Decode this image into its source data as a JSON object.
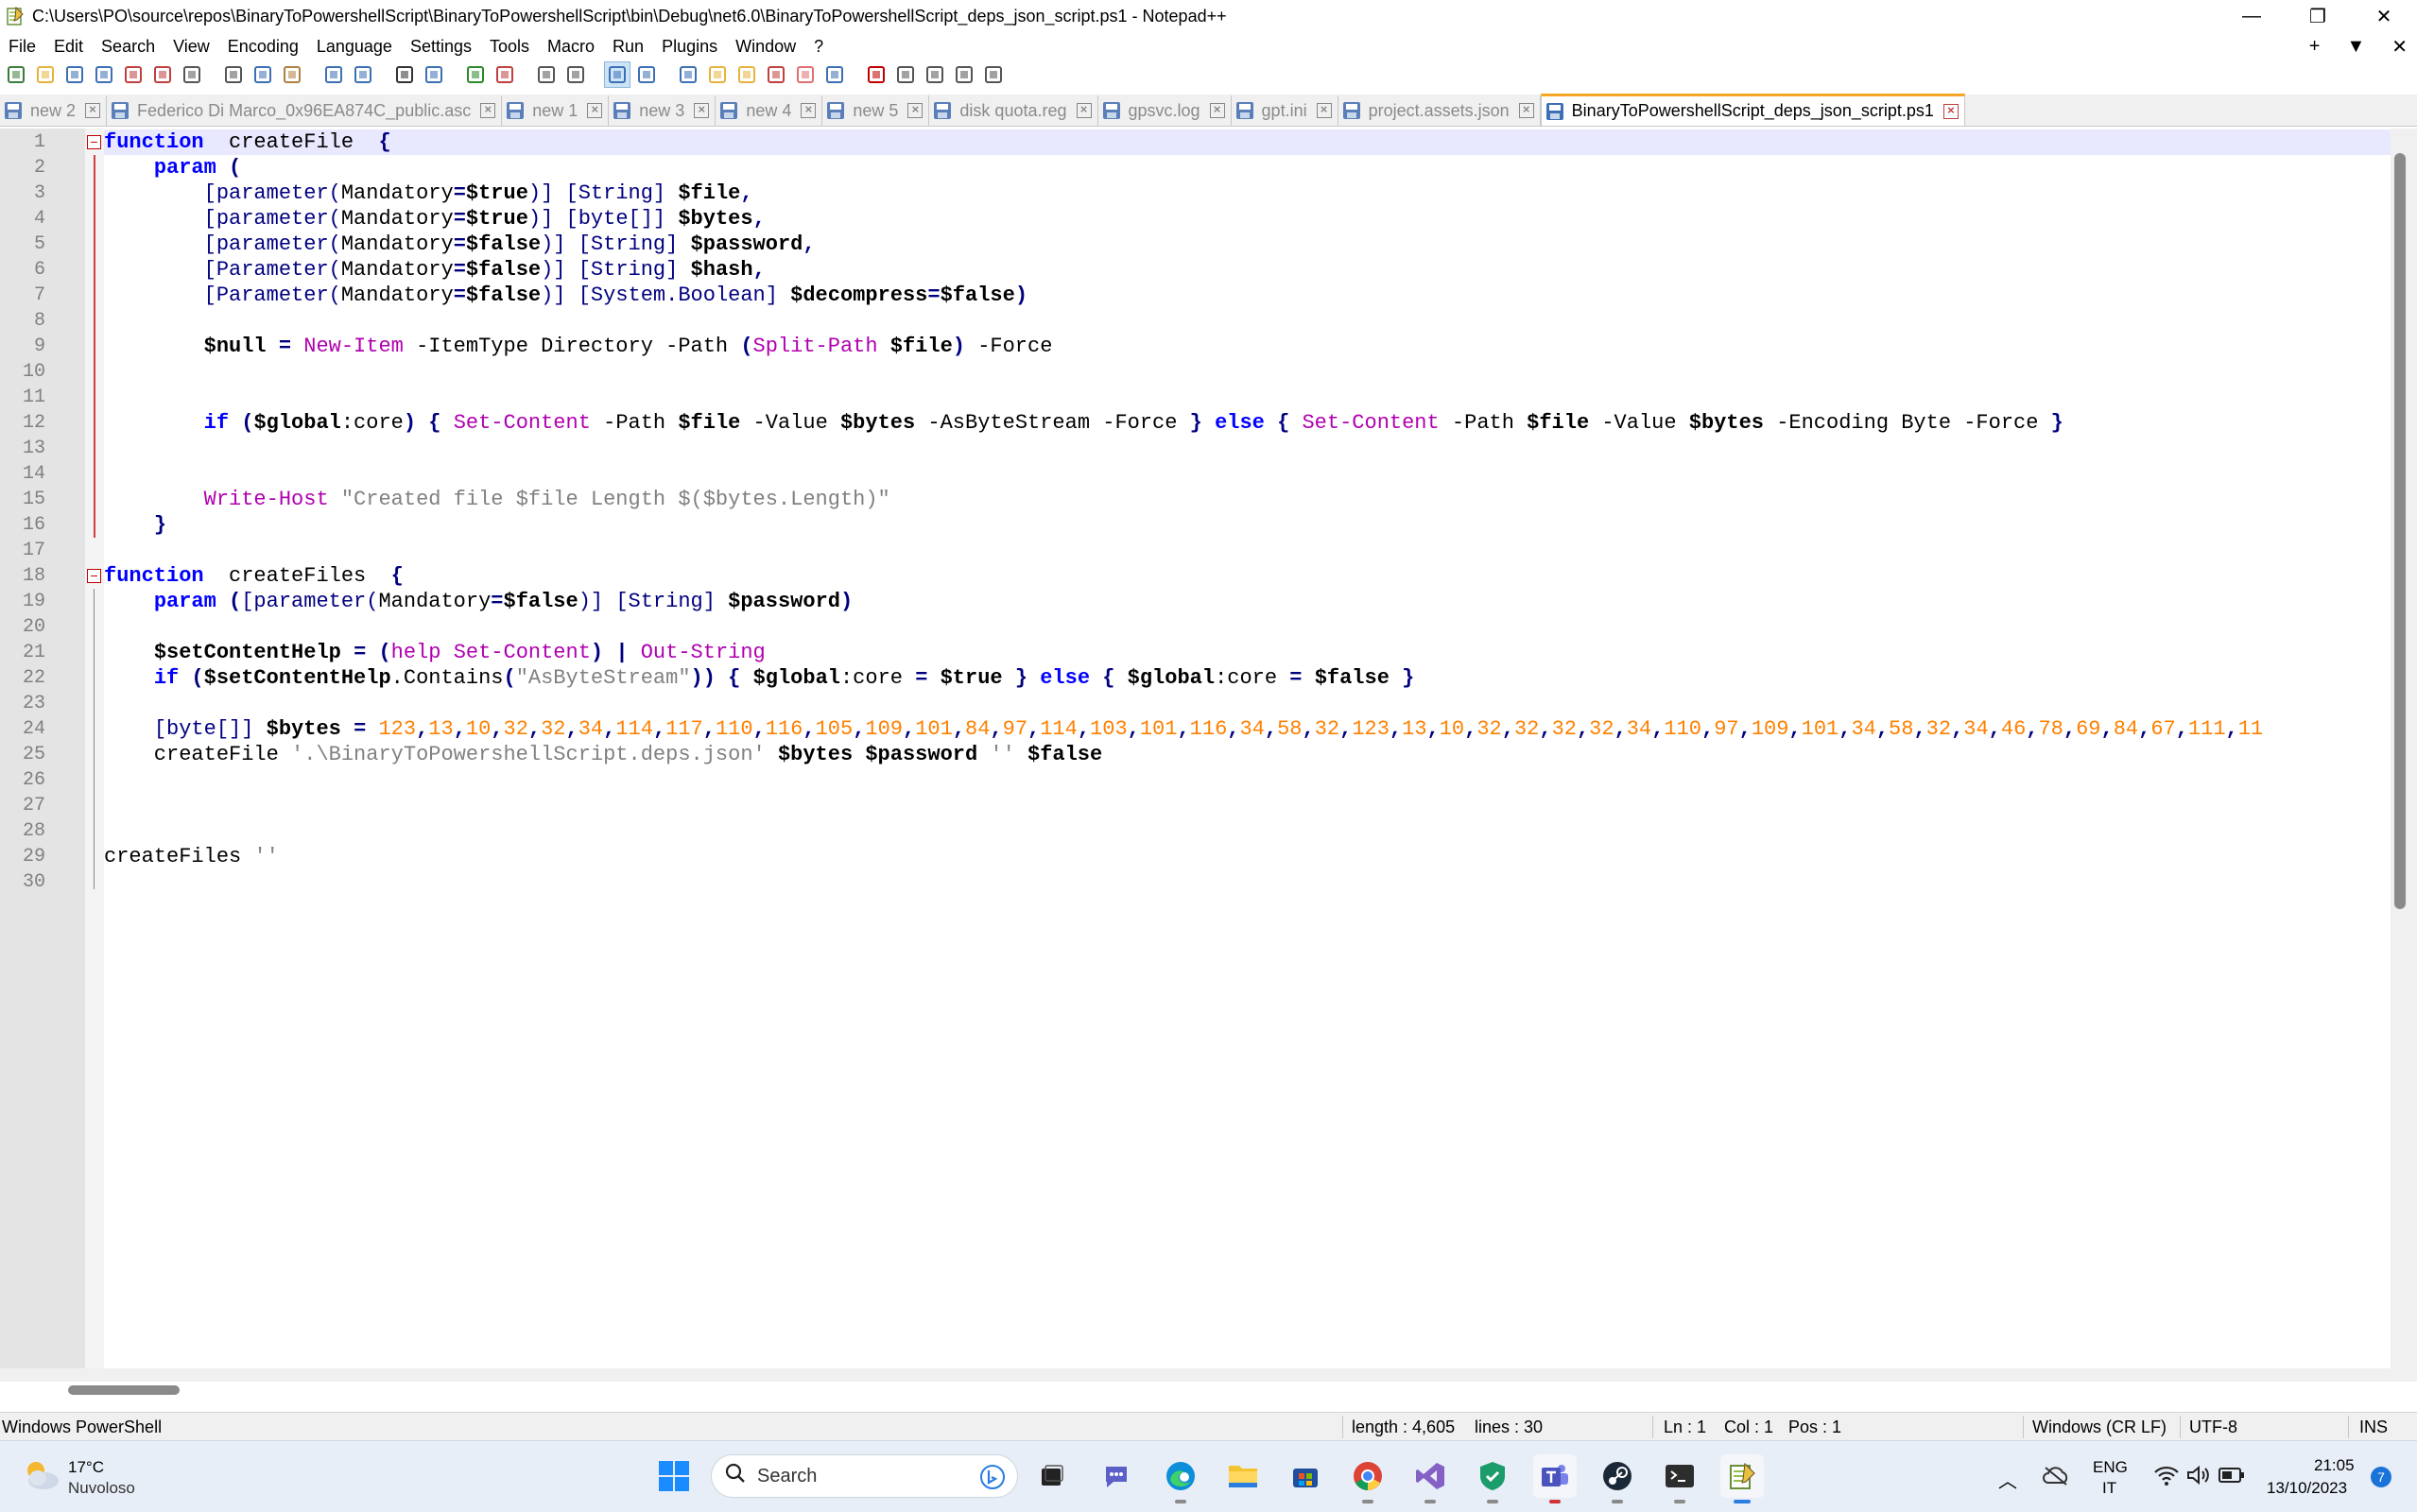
{
  "window": {
    "title": "C:\\Users\\PO\\source\\repos\\BinaryToPowershellScript\\BinaryToPowershellScript\\bin\\Debug\\net6.0\\BinaryToPowershellScript_deps_json_script.ps1 - Notepad++",
    "minimize": "—",
    "restore": "❐",
    "close": "✕"
  },
  "menu": {
    "items": [
      "File",
      "Edit",
      "Search",
      "View",
      "Encoding",
      "Language",
      "Settings",
      "Tools",
      "Macro",
      "Run",
      "Plugins",
      "Window",
      "?"
    ],
    "right": [
      "+",
      "▼",
      "✕"
    ]
  },
  "tabs": [
    {
      "label": "new 2",
      "active": false,
      "icon": "blue"
    },
    {
      "label": "Federico Di Marco_0x96EA874C_public.asc",
      "active": false,
      "icon": "blue"
    },
    {
      "label": "new 1",
      "active": false,
      "icon": "blue"
    },
    {
      "label": "new 3",
      "active": false,
      "icon": "blue"
    },
    {
      "label": "new 4",
      "active": false,
      "icon": "blue"
    },
    {
      "label": "new 5",
      "active": false,
      "icon": "blue"
    },
    {
      "label": "disk quota.reg",
      "active": false,
      "icon": "blue"
    },
    {
      "label": "gpsvc.log",
      "active": false,
      "icon": "blue"
    },
    {
      "label": "gpt.ini",
      "active": false,
      "icon": "blue"
    },
    {
      "label": "project.assets.json",
      "active": false,
      "icon": "blue"
    },
    {
      "label": "BinaryToPowershellScript_deps_json_script.ps1",
      "active": true,
      "icon": "blue"
    }
  ],
  "editor": {
    "line_numbers": [
      "1",
      "2",
      "3",
      "4",
      "5",
      "6",
      "7",
      "8",
      "9",
      "10",
      "11",
      "12",
      "13",
      "14",
      "15",
      "16",
      "17",
      "18",
      "19",
      "20",
      "21",
      "22",
      "23",
      "24",
      "25",
      "26",
      "27",
      "28",
      "29",
      "30"
    ],
    "lines": [
      [
        [
          "kw",
          "function"
        ],
        [
          "",
          "  createFile  "
        ],
        [
          "br",
          "{"
        ]
      ],
      [
        [
          "",
          "    "
        ],
        [
          "kw",
          "param"
        ],
        [
          "",
          ""
        ],
        [
          "br",
          " ("
        ]
      ],
      [
        [
          "",
          "        "
        ],
        [
          "typ",
          "[parameter("
        ],
        [
          "",
          "Mandatory"
        ],
        [
          "op",
          "="
        ],
        [
          "var",
          "$true"
        ],
        [
          "typ",
          ")]"
        ],
        [
          "",
          " "
        ],
        [
          "typ",
          "[String]"
        ],
        [
          "",
          " "
        ],
        [
          "var",
          "$file"
        ],
        [
          "op",
          ","
        ]
      ],
      [
        [
          "",
          "        "
        ],
        [
          "typ",
          "[parameter("
        ],
        [
          "",
          "Mandatory"
        ],
        [
          "op",
          "="
        ],
        [
          "var",
          "$true"
        ],
        [
          "typ",
          ")]"
        ],
        [
          "",
          " "
        ],
        [
          "typ",
          "[byte[]]"
        ],
        [
          "",
          " "
        ],
        [
          "var",
          "$bytes"
        ],
        [
          "op",
          ","
        ]
      ],
      [
        [
          "",
          "        "
        ],
        [
          "typ",
          "[parameter("
        ],
        [
          "",
          "Mandatory"
        ],
        [
          "op",
          "="
        ],
        [
          "var",
          "$false"
        ],
        [
          "typ",
          ")]"
        ],
        [
          "",
          " "
        ],
        [
          "typ",
          "[String]"
        ],
        [
          "",
          " "
        ],
        [
          "var",
          "$password"
        ],
        [
          "op",
          ","
        ]
      ],
      [
        [
          "",
          "        "
        ],
        [
          "typ",
          "[Parameter("
        ],
        [
          "",
          "Mandatory"
        ],
        [
          "op",
          "="
        ],
        [
          "var",
          "$false"
        ],
        [
          "typ",
          ")]"
        ],
        [
          "",
          " "
        ],
        [
          "typ",
          "[String]"
        ],
        [
          "",
          " "
        ],
        [
          "var",
          "$hash"
        ],
        [
          "op",
          ","
        ]
      ],
      [
        [
          "",
          "        "
        ],
        [
          "typ",
          "[Parameter("
        ],
        [
          "",
          "Mandatory"
        ],
        [
          "op",
          "="
        ],
        [
          "var",
          "$false"
        ],
        [
          "typ",
          ")]"
        ],
        [
          "",
          " "
        ],
        [
          "typ",
          "[System.Boolean]"
        ],
        [
          "",
          " "
        ],
        [
          "var",
          "$decompress"
        ],
        [
          "op",
          "="
        ],
        [
          "var",
          "$false"
        ],
        [
          "br",
          ")"
        ]
      ],
      [
        [
          "",
          ""
        ]
      ],
      [
        [
          "",
          "        "
        ],
        [
          "var",
          "$null"
        ],
        [
          "",
          " "
        ],
        [
          "op",
          "="
        ],
        [
          "",
          " "
        ],
        [
          "cmd",
          "New-Item"
        ],
        [
          "",
          " -ItemType Directory -Path "
        ],
        [
          "br",
          "("
        ],
        [
          "cmd",
          "Split-Path"
        ],
        [
          "",
          " "
        ],
        [
          "var",
          "$file"
        ],
        [
          "br",
          ")"
        ],
        [
          "",
          " -Force"
        ]
      ],
      [
        [
          "",
          ""
        ]
      ],
      [
        [
          "",
          ""
        ]
      ],
      [
        [
          "",
          "        "
        ],
        [
          "kw",
          "if"
        ],
        [
          "",
          " "
        ],
        [
          "br",
          "("
        ],
        [
          "var",
          "$global"
        ],
        [
          "",
          ":core"
        ],
        [
          "br",
          ")"
        ],
        [
          "",
          " "
        ],
        [
          "br",
          "{"
        ],
        [
          "",
          " "
        ],
        [
          "cmd",
          "Set-Content"
        ],
        [
          "",
          " -Path "
        ],
        [
          "var",
          "$file"
        ],
        [
          "",
          " -Value "
        ],
        [
          "var",
          "$bytes"
        ],
        [
          "",
          " -AsByteStream -Force "
        ],
        [
          "br",
          "}"
        ],
        [
          "",
          " "
        ],
        [
          "kw",
          "else"
        ],
        [
          "",
          " "
        ],
        [
          "br",
          "{"
        ],
        [
          "",
          " "
        ],
        [
          "cmd",
          "Set-Content"
        ],
        [
          "",
          " -Path "
        ],
        [
          "var",
          "$file"
        ],
        [
          "",
          " -Value "
        ],
        [
          "var",
          "$bytes"
        ],
        [
          "",
          " -Encoding Byte -Force "
        ],
        [
          "br",
          "}"
        ]
      ],
      [
        [
          "",
          ""
        ]
      ],
      [
        [
          "",
          ""
        ]
      ],
      [
        [
          "",
          "        "
        ],
        [
          "cmd",
          "Write-Host"
        ],
        [
          "",
          " "
        ],
        [
          "str",
          "\"Created file $file Length $($bytes.Length)\""
        ]
      ],
      [
        [
          "",
          "    "
        ],
        [
          "br",
          "}"
        ]
      ],
      [
        [
          "",
          ""
        ]
      ],
      [
        [
          "kw",
          "function"
        ],
        [
          "",
          "  createFiles  "
        ],
        [
          "br",
          "{"
        ]
      ],
      [
        [
          "",
          "    "
        ],
        [
          "kw",
          "param"
        ],
        [
          "",
          " "
        ],
        [
          "br",
          "("
        ],
        [
          "typ",
          "[parameter("
        ],
        [
          "",
          "Mandatory"
        ],
        [
          "op",
          "="
        ],
        [
          "var",
          "$false"
        ],
        [
          "typ",
          ")]"
        ],
        [
          "",
          " "
        ],
        [
          "typ",
          "[String]"
        ],
        [
          "",
          " "
        ],
        [
          "var",
          "$password"
        ],
        [
          "br",
          ")"
        ]
      ],
      [
        [
          "",
          ""
        ]
      ],
      [
        [
          "",
          "    "
        ],
        [
          "var",
          "$setContentHelp"
        ],
        [
          "",
          " "
        ],
        [
          "op",
          "="
        ],
        [
          "",
          " "
        ],
        [
          "br",
          "("
        ],
        [
          "cmd",
          "help"
        ],
        [
          "",
          " "
        ],
        [
          "cmd",
          "Set-Content"
        ],
        [
          "br",
          ")"
        ],
        [
          "",
          " "
        ],
        [
          "op",
          "|"
        ],
        [
          "",
          " "
        ],
        [
          "cmd",
          "Out-String"
        ]
      ],
      [
        [
          "",
          "    "
        ],
        [
          "kw",
          "if"
        ],
        [
          "",
          " "
        ],
        [
          "br",
          "("
        ],
        [
          "var",
          "$setContentHelp"
        ],
        [
          "",
          ".Contains"
        ],
        [
          "br",
          "("
        ],
        [
          "str",
          "\"AsByteStream\""
        ],
        [
          "br",
          "))"
        ],
        [
          "",
          " "
        ],
        [
          "br",
          "{"
        ],
        [
          "",
          " "
        ],
        [
          "var",
          "$global"
        ],
        [
          "",
          ":core "
        ],
        [
          "op",
          "="
        ],
        [
          "",
          " "
        ],
        [
          "var",
          "$true"
        ],
        [
          "",
          " "
        ],
        [
          "br",
          "}"
        ],
        [
          "",
          " "
        ],
        [
          "kw",
          "else"
        ],
        [
          "",
          " "
        ],
        [
          "br",
          "{"
        ],
        [
          "",
          " "
        ],
        [
          "var",
          "$global"
        ],
        [
          "",
          ":core "
        ],
        [
          "op",
          "="
        ],
        [
          "",
          " "
        ],
        [
          "var",
          "$false"
        ],
        [
          "",
          " "
        ],
        [
          "br",
          "}"
        ]
      ],
      [
        [
          "",
          ""
        ]
      ],
      [
        [
          "",
          "    "
        ],
        [
          "typ",
          "[byte[]]"
        ],
        [
          "",
          " "
        ],
        [
          "var",
          "$bytes"
        ],
        [
          "",
          " "
        ],
        [
          "op",
          "="
        ],
        [
          "",
          " "
        ],
        [
          "num",
          "123"
        ],
        [
          "op",
          ","
        ],
        [
          "num",
          "13"
        ],
        [
          "op",
          ","
        ],
        [
          "num",
          "10"
        ],
        [
          "op",
          ","
        ],
        [
          "num",
          "32"
        ],
        [
          "op",
          ","
        ],
        [
          "num",
          "32"
        ],
        [
          "op",
          ","
        ],
        [
          "num",
          "34"
        ],
        [
          "op",
          ","
        ],
        [
          "num",
          "114"
        ],
        [
          "op",
          ","
        ],
        [
          "num",
          "117"
        ],
        [
          "op",
          ","
        ],
        [
          "num",
          "110"
        ],
        [
          "op",
          ","
        ],
        [
          "num",
          "116"
        ],
        [
          "op",
          ","
        ],
        [
          "num",
          "105"
        ],
        [
          "op",
          ","
        ],
        [
          "num",
          "109"
        ],
        [
          "op",
          ","
        ],
        [
          "num",
          "101"
        ],
        [
          "op",
          ","
        ],
        [
          "num",
          "84"
        ],
        [
          "op",
          ","
        ],
        [
          "num",
          "97"
        ],
        [
          "op",
          ","
        ],
        [
          "num",
          "114"
        ],
        [
          "op",
          ","
        ],
        [
          "num",
          "103"
        ],
        [
          "op",
          ","
        ],
        [
          "num",
          "101"
        ],
        [
          "op",
          ","
        ],
        [
          "num",
          "116"
        ],
        [
          "op",
          ","
        ],
        [
          "num",
          "34"
        ],
        [
          "op",
          ","
        ],
        [
          "num",
          "58"
        ],
        [
          "op",
          ","
        ],
        [
          "num",
          "32"
        ],
        [
          "op",
          ","
        ],
        [
          "num",
          "123"
        ],
        [
          "op",
          ","
        ],
        [
          "num",
          "13"
        ],
        [
          "op",
          ","
        ],
        [
          "num",
          "10"
        ],
        [
          "op",
          ","
        ],
        [
          "num",
          "32"
        ],
        [
          "op",
          ","
        ],
        [
          "num",
          "32"
        ],
        [
          "op",
          ","
        ],
        [
          "num",
          "32"
        ],
        [
          "op",
          ","
        ],
        [
          "num",
          "32"
        ],
        [
          "op",
          ","
        ],
        [
          "num",
          "34"
        ],
        [
          "op",
          ","
        ],
        [
          "num",
          "110"
        ],
        [
          "op",
          ","
        ],
        [
          "num",
          "97"
        ],
        [
          "op",
          ","
        ],
        [
          "num",
          "109"
        ],
        [
          "op",
          ","
        ],
        [
          "num",
          "101"
        ],
        [
          "op",
          ","
        ],
        [
          "num",
          "34"
        ],
        [
          "op",
          ","
        ],
        [
          "num",
          "58"
        ],
        [
          "op",
          ","
        ],
        [
          "num",
          "32"
        ],
        [
          "op",
          ","
        ],
        [
          "num",
          "34"
        ],
        [
          "op",
          ","
        ],
        [
          "num",
          "46"
        ],
        [
          "op",
          ","
        ],
        [
          "num",
          "78"
        ],
        [
          "op",
          ","
        ],
        [
          "num",
          "69"
        ],
        [
          "op",
          ","
        ],
        [
          "num",
          "84"
        ],
        [
          "op",
          ","
        ],
        [
          "num",
          "67"
        ],
        [
          "op",
          ","
        ],
        [
          "num",
          "111"
        ],
        [
          "op",
          ","
        ],
        [
          "num",
          "11"
        ]
      ],
      [
        [
          "",
          "    createFile "
        ],
        [
          "str",
          "'.\\BinaryToPowershellScript.deps.json'"
        ],
        [
          "",
          " "
        ],
        [
          "var",
          "$bytes"
        ],
        [
          "",
          " "
        ],
        [
          "var",
          "$password"
        ],
        [
          "",
          " "
        ],
        [
          "str",
          "''"
        ],
        [
          "",
          " "
        ],
        [
          "var",
          "$false"
        ]
      ],
      [
        [
          "",
          ""
        ]
      ],
      [
        [
          "",
          ""
        ]
      ],
      [
        [
          "",
          ""
        ]
      ],
      [
        [
          "",
          "createFiles "
        ],
        [
          "str",
          "''"
        ]
      ],
      [
        [
          "",
          ""
        ]
      ]
    ]
  },
  "status": {
    "doc_type": "Windows PowerShell",
    "length": "length : 4,605",
    "lines": "lines : 30",
    "ln": "Ln : 1",
    "col": "Col : 1",
    "pos": "Pos : 1",
    "eol": "Windows (CR LF)",
    "encoding": "UTF-8",
    "mode": "INS"
  },
  "taskbar": {
    "weather_temp": "17°C",
    "weather_desc": "Nuvoloso",
    "search_placeholder": "Search",
    "lang_top": "ENG",
    "lang_bottom": "IT",
    "time": "21:05",
    "date": "13/10/2023",
    "notification_count": "7"
  }
}
